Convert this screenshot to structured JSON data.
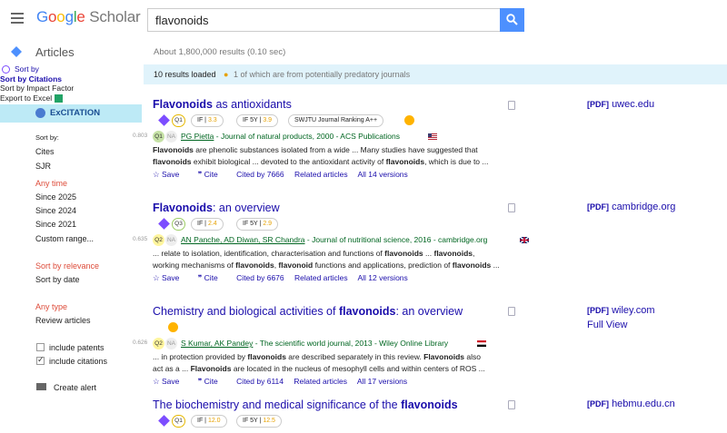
{
  "header": {
    "logo_google": "Google",
    "logo_scholar": "Scholar",
    "search_value": "flavonoids"
  },
  "subbar": {
    "section": "Articles",
    "results_count": "About 1,800,000 results (0.10 sec)"
  },
  "popup": {
    "sort_by": "Sort by",
    "sort_citations": "Sort by Citations",
    "sort_impact": "Sort by Impact Factor",
    "export": "Export to Excel"
  },
  "excitation": "ExCITATION",
  "sidebar": {
    "sort_by_label": "Sort by:",
    "cites": "Cites",
    "sjr": "SJR",
    "any_time": "Any time",
    "since_2025": "Since 2025",
    "since_2024": "Since 2024",
    "since_2021": "Since 2021",
    "custom_range": "Custom range...",
    "sort_relevance": "Sort by relevance",
    "sort_date": "Sort by date",
    "any_type": "Any type",
    "review_articles": "Review articles",
    "include_patents": "include patents",
    "include_citations": "include citations",
    "create_alert": "Create alert"
  },
  "banner": {
    "loaded": "10 results loaded",
    "predatory": "1 of which are from potentially predatory journals"
  },
  "results": [
    {
      "title_bold": "Flavonoids",
      "title_rest": " as antioxidants",
      "q": "Q1",
      "if_label": "IF",
      "if_val": "3.3",
      "if5_label": "IF 5Y",
      "if5_val": "3.9",
      "ranking": "SWJTU Journal Ranking A++",
      "score": "0.803",
      "qa": "Q1",
      "na": "NA",
      "authors": "PG Pietta",
      "source": " - Journal of natural products, 2000 - ACS Publications",
      "snippet1_b": "Flavonoids",
      "snippet1": " are phenolic substances isolated from a wide ... Many studies have suggested that",
      "snippet2_b": "flavonoids",
      "snippet2": " exhibit biological ... devoted to the antioxidant activity of ",
      "snippet2_b2": "flavonoids",
      "snippet2_end": ", which is due to ...",
      "save": "Save",
      "cite": "Cite",
      "cited_by": "Cited by 7666",
      "related": "Related articles",
      "versions": "All 14 versions",
      "pdf_tag": "[PDF]",
      "pdf_domain": "uwec.edu"
    },
    {
      "title_bold": "Flavonoids",
      "title_rest": ": an overview",
      "q": "Q3",
      "if_label": "IF",
      "if_val": "2.4",
      "if5_label": "IF 5Y",
      "if5_val": "2.9",
      "score": "0.635",
      "qa": "Q2",
      "na": "NA",
      "authors": "AN Panche, AD Diwan, SR Chandra",
      "source": " - Journal of nutritional science, 2016 - cambridge.org",
      "snippet1": "... relate to isolation, identification, characterisation and functions of ",
      "snippet1_b": "flavonoids",
      "snippet1_mid": " ... ",
      "snippet1_b2": "flavonoids",
      "snippet1_end": ",",
      "snippet2": "working mechanisms of ",
      "snippet2_b": "flavonoids",
      "snippet2_mid": ", ",
      "snippet2_b2": "flavonoid",
      "snippet2_mid2": " functions and applications, prediction of ",
      "snippet2_b3": "flavonoids",
      "snippet2_end": " ...",
      "save": "Save",
      "cite": "Cite",
      "cited_by": "Cited by 6676",
      "related": "Related articles",
      "versions": "All 12 versions",
      "pdf_tag": "[PDF]",
      "pdf_domain": "cambridge.org"
    },
    {
      "title_pre": "Chemistry and biological activities of ",
      "title_bold": "flavonoids",
      "title_rest": ": an overview",
      "score": "0.626",
      "qa": "Q2",
      "na": "NA",
      "authors": "S Kumar, AK Pandey",
      "source": " - The scientific world journal, 2013 - Wiley Online Library",
      "snippet1": "... in protection provided by ",
      "snippet1_b": "flavonoids",
      "snippet1_mid": " are described separately in this review. ",
      "snippet1_b2": "Flavonoids",
      "snippet1_end": " also",
      "snippet2": "act as a ... ",
      "snippet2_b": "Flavonoids",
      "snippet2_end": " are located in the nucleus of mesophyll cells and within centers of ROS ...",
      "save": "Save",
      "cite": "Cite",
      "cited_by": "Cited by 6114",
      "related": "Related articles",
      "versions": "All 17 versions",
      "pdf_tag": "[PDF]",
      "pdf_domain": "wiley.com",
      "full_view": "Full View"
    },
    {
      "title_pre": "The biochemistry and medical significance of the ",
      "title_bold": "flavonoids",
      "q": "Q1",
      "if_label": "IF",
      "if_val": "12.0",
      "if5_label": "IF 5Y",
      "if5_val": "12.5",
      "pdf_tag": "[PDF]",
      "pdf_domain": "hebmu.edu.cn"
    }
  ]
}
